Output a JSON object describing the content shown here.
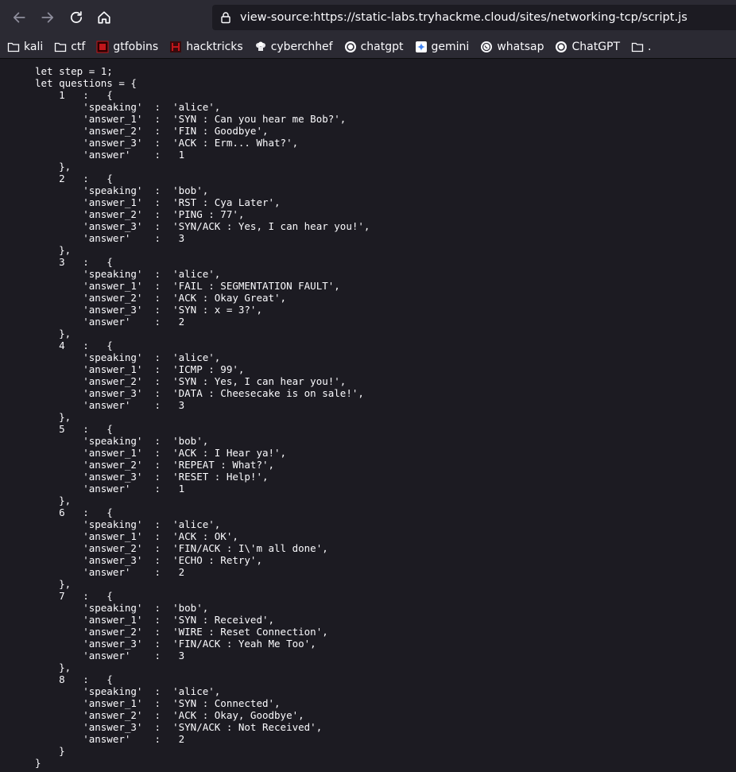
{
  "toolbar": {
    "url": "view-source:https://static-labs.tryhackme.cloud/sites/networking-tcp/script.js"
  },
  "bookmarks": [
    {
      "label": "kali",
      "icon": "folder-icon"
    },
    {
      "label": "ctf",
      "icon": "folder-icon"
    },
    {
      "label": "gtfobins",
      "icon": "gtfobins-favicon-icon",
      "color": "#c2161b"
    },
    {
      "label": "hacktricks",
      "icon": "hacktricks-favicon-icon",
      "color": "#c2161b"
    },
    {
      "label": "cyberchhef",
      "icon": "chef-hat-icon"
    },
    {
      "label": "chatgpt",
      "icon": "openai-logo-icon"
    },
    {
      "label": "gemini",
      "icon": "gemini-sparkle-icon",
      "color": "#4285f4"
    },
    {
      "label": "whatsap",
      "icon": "whatsapp-logo-icon"
    },
    {
      "label": "ChatGPT",
      "icon": "openai-logo-icon"
    },
    {
      "label": ".",
      "icon": "folder-icon"
    }
  ],
  "source_lines": [
    "let step = 1;",
    "let questions = {",
    "    1   :   {",
    "        'speaking'  :  'alice',",
    "        'answer_1'  :  'SYN : Can you hear me Bob?',",
    "        'answer_2'  :  'FIN : Goodbye',",
    "        'answer_3'  :  'ACK : Erm... What?',",
    "        'answer'    :   1",
    "    },",
    "    2   :   {",
    "        'speaking'  :  'bob',",
    "        'answer_1'  :  'RST : Cya Later',",
    "        'answer_2'  :  'PING : 77',",
    "        'answer_3'  :  'SYN/ACK : Yes, I can hear you!',",
    "        'answer'    :   3",
    "    },",
    "    3   :   {",
    "        'speaking'  :  'alice',",
    "        'answer_1'  :  'FAIL : SEGMENTATION FAULT',",
    "        'answer_2'  :  'ACK : Okay Great',",
    "        'answer_3'  :  'SYN : x = 3?',",
    "        'answer'    :   2",
    "    },",
    "    4   :   {",
    "        'speaking'  :  'alice',",
    "        'answer_1'  :  'ICMP : 99',",
    "        'answer_2'  :  'SYN : Yes, I can hear you!',",
    "        'answer_3'  :  'DATA : Cheesecake is on sale!',",
    "        'answer'    :   3",
    "    },",
    "    5   :   {",
    "        'speaking'  :  'bob',",
    "        'answer_1'  :  'ACK : I Hear ya!',",
    "        'answer_2'  :  'REPEAT : What?',",
    "        'answer_3'  :  'RESET : Help!',",
    "        'answer'    :   1",
    "    },",
    "    6   :   {",
    "        'speaking'  :  'alice',",
    "        'answer_1'  :  'ACK : OK',",
    "        'answer_2'  :  'FIN/ACK : I\\'m all done',",
    "        'answer_3'  :  'ECHO : Retry',",
    "        'answer'    :   2",
    "    },",
    "    7   :   {",
    "        'speaking'  :  'bob',",
    "        'answer_1'  :  'SYN : Received',",
    "        'answer_2'  :  'WIRE : Reset Connection',",
    "        'answer_3'  :  'FIN/ACK : Yeah Me Too',",
    "        'answer'    :   3",
    "    },",
    "    8   :   {",
    "        'speaking'  :  'alice',",
    "        'answer_1'  :  'SYN : Connected',",
    "        'answer_2'  :  'ACK : Okay, Goodbye',",
    "        'answer_3'  :  'SYN/ACK : Not Received',",
    "        'answer'    :   2",
    "    }",
    "}"
  ]
}
